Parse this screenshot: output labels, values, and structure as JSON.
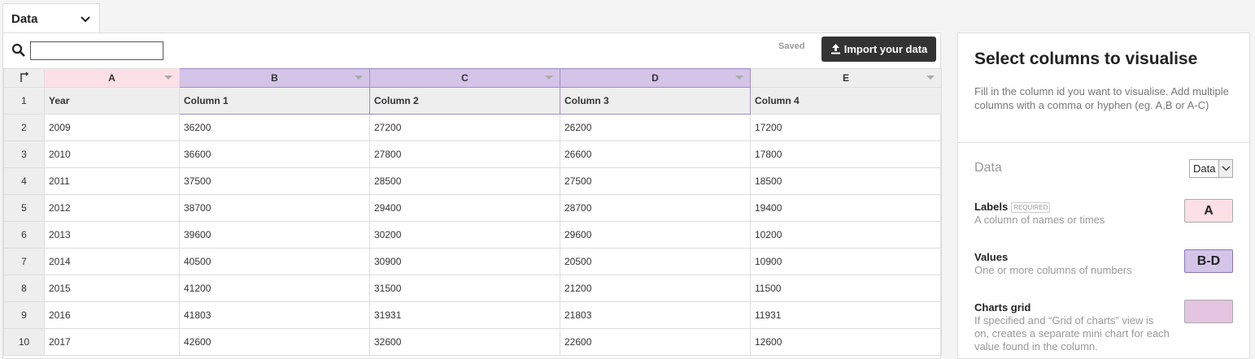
{
  "tab": {
    "label": "Data"
  },
  "toolbar": {
    "saved": "Saved",
    "import_label": "Import your data",
    "search_value": ""
  },
  "grid": {
    "column_letters": [
      "A",
      "B",
      "C",
      "D",
      "E"
    ],
    "header_row": {
      "num": "1",
      "cells": [
        "Year",
        "Column 1",
        "Column 2",
        "Column 3",
        "Column 4"
      ]
    },
    "rows": [
      {
        "num": "2",
        "cells": [
          "2009",
          "36200",
          "27200",
          "26200",
          "17200"
        ]
      },
      {
        "num": "3",
        "cells": [
          "2010",
          "36600",
          "27800",
          "26600",
          "17800"
        ]
      },
      {
        "num": "4",
        "cells": [
          "2011",
          "37500",
          "28500",
          "27500",
          "18500"
        ]
      },
      {
        "num": "5",
        "cells": [
          "2012",
          "38700",
          "29400",
          "28700",
          "19400"
        ]
      },
      {
        "num": "6",
        "cells": [
          "2013",
          "39600",
          "30200",
          "29600",
          "10200"
        ]
      },
      {
        "num": "7",
        "cells": [
          "2014",
          "40500",
          "30900",
          "20500",
          "10900"
        ]
      },
      {
        "num": "8",
        "cells": [
          "2015",
          "41200",
          "31500",
          "21200",
          "11500"
        ]
      },
      {
        "num": "9",
        "cells": [
          "2016",
          "41803",
          "31931",
          "21803",
          "11931"
        ]
      },
      {
        "num": "10",
        "cells": [
          "2017",
          "42600",
          "32600",
          "22600",
          "12600"
        ]
      }
    ]
  },
  "panel": {
    "title": "Select columns to visualise",
    "description": "Fill in the column id you want to visualise. Add multiple columns with a comma or hyphen (eg. A,B or A-C)",
    "data_label": "Data",
    "data_select": "Data",
    "labels": {
      "title": "Labels",
      "required": "REQUIRED",
      "desc": "A column of names or times",
      "value": "A"
    },
    "values": {
      "title": "Values",
      "desc": "One or more columns of numbers",
      "value": "B-D"
    },
    "charts_grid": {
      "title": "Charts grid",
      "desc": "If specified and “Grid of charts” view is on, creates a separate mini chart for each value found in the column.",
      "value": ""
    }
  },
  "colors": {
    "labels_col": "#fde0e6",
    "values_col": "#d3c4e8",
    "grid_box": "#e5c4e2",
    "button_bg": "#333333"
  }
}
